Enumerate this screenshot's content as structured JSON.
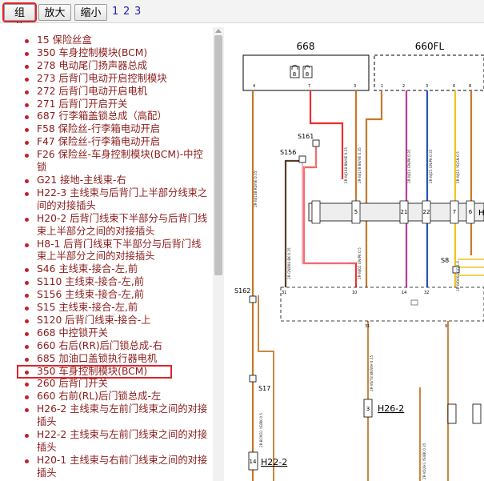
{
  "toolbar": {
    "components_label": "组件",
    "zoom_in_label": "放大",
    "zoom_out_label": "缩小",
    "pages": [
      "1",
      "2",
      "3"
    ]
  },
  "component_list": [
    "15 保险丝盒",
    "350 车身控制模块(BCM)",
    "278 电动尾门扬声器总成",
    "273 后背门电动开启控制模块",
    "272 后背门电动开启电机",
    "271 后背门开启开关",
    "687 行李箱盖锁总成（高配）",
    "F58 保险丝-行李箱电动开启",
    "F47 保险丝-行李箱电动开启",
    "F26 保险丝-车身控制模块(BCM)-中控锁",
    "G21 接地-主线束-右",
    "H22-3 主线束与后背门上半部分线束之间的对接插头",
    "H20-2 后背门线束下半部分与后背门线束上半部分之间的对接插头",
    "H8-1 后背门线束下半部分与后背门线束上半部分之间的对接插头",
    "S46 主线束-接合-左,前",
    "S110 主线束-接合-左,前",
    "S156 主线束-接合-左,前",
    "S15 主线束-接合-左,前",
    "S120 后背门线束-接合-上",
    "668 中控锁开关",
    "660 右后(RR)后门锁总成-右",
    "685 加油口盖锁执行器电机",
    "350 车身控制模块(BCM)",
    "260 后背门开关",
    "660 右前(RL)后门锁总成-左",
    "H26-2 主线束与左前门线束之间的对接插头",
    "H22-2 主线束与左前门线束之间的对接插头",
    "H20-1 主线束与右前门线束之间的对接插头"
  ],
  "highlighted_index": 22,
  "diagram": {
    "component_668": "668",
    "component_660fl": "660FL",
    "splice_s161": "S161",
    "splice_s156": "S156",
    "splice_s162": "S162",
    "splice_s17": "S17",
    "splice_s8": "S8",
    "connector_h26_2": "H26-2",
    "connector_h22_2": "H22-2",
    "connector_h_partial": "H",
    "pin_4": "4",
    "pin_7": "7",
    "pin_3": "3",
    "pin_1": "1",
    "pin_2": "2",
    "pin_6": "6",
    "pin_8": "8",
    "pin_5": "5",
    "pin_21": "21",
    "pin_22": "22",
    "pin_14": "14",
    "pin_10": "10",
    "pin_32": "32",
    "pin_31": "31",
    "pin_9": "9",
    "lock_a": "8",
    "lock_b": "8",
    "wire_codes": [
      "2R-WJ10B RD/VE 0.35",
      "2R-WJ168 BN/VE 0.35",
      "2R-WJ17B BK/VE 0.35",
      "2R-WJ14 GN/PK 0.35",
      "2R-WJ25 GN/PK 0.35",
      "2R-WJ15 YE/GN 0.5",
      "2R-WJ02 GN/PK 0.5",
      "2R-GND08 BK 0.35",
      "2R-BCM31 YE/BK 0.5",
      "2R-VE/T8 BK/WH 0.35",
      "2R-WD061 OG 1.0",
      "2R-VD2H1 YE/BK 0.35"
    ]
  },
  "colors": {
    "highlight_red": "#e0242b",
    "list_text": "#8b1c1c",
    "wire_orange": "#c8782a",
    "wire_red": "#ef2f2f",
    "wire_pink": "#f08aa8",
    "wire_magenta": "#c2389e",
    "wire_blue": "#2a52b8",
    "wire_yellow": "#f2c21c",
    "wire_dark": "#5a3a2a"
  }
}
